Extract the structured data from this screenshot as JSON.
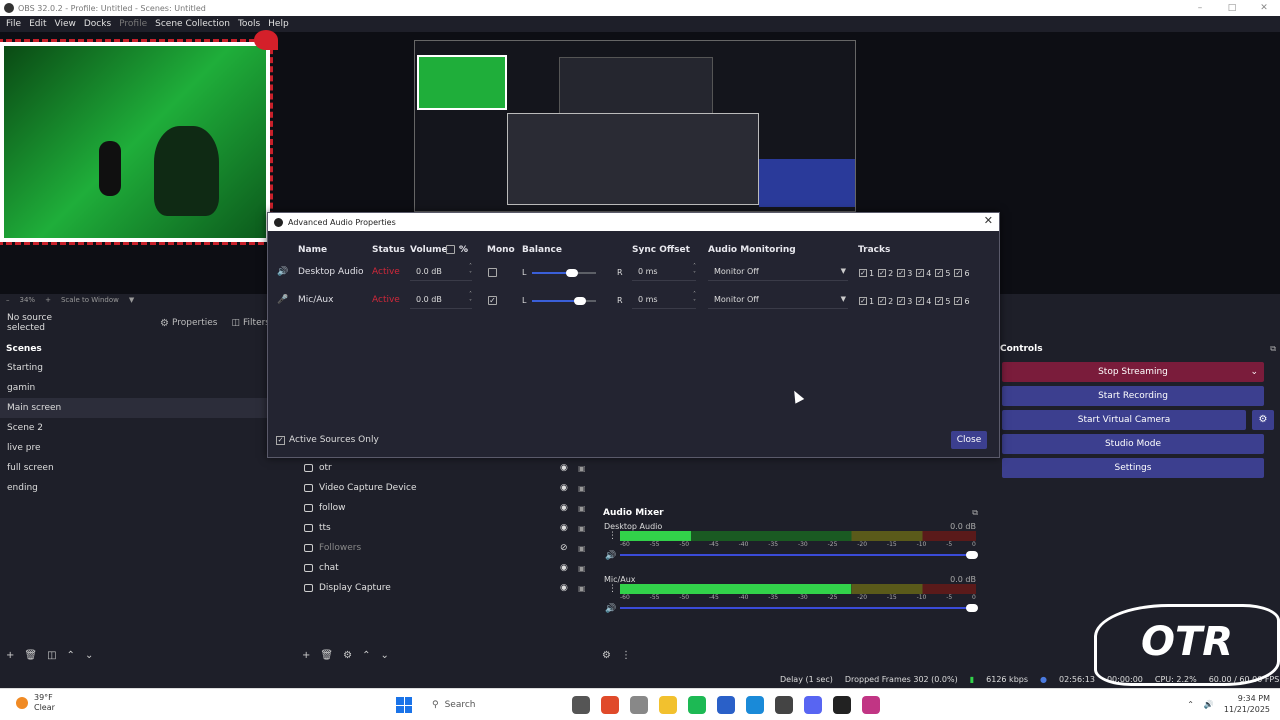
{
  "window": {
    "title": "OBS 32.0.2 - Profile: Untitled - Scenes: Untitled"
  },
  "menu": [
    {
      "label": "File",
      "dim": false
    },
    {
      "label": "Edit",
      "dim": false
    },
    {
      "label": "View",
      "dim": false
    },
    {
      "label": "Docks",
      "dim": false
    },
    {
      "label": "Profile",
      "dim": true
    },
    {
      "label": "Scene Collection",
      "dim": false
    },
    {
      "label": "Tools",
      "dim": false
    },
    {
      "label": "Help",
      "dim": false
    }
  ],
  "preview": {
    "zoom": "34%",
    "scale_mode": "Scale to Window"
  },
  "source_toolbar": {
    "no_selection": "No source selected",
    "properties": "Properties",
    "filters": "Filters"
  },
  "scenes": {
    "title": "Scenes",
    "items": [
      "Starting",
      "gamin",
      "Main screen",
      "Scene 2",
      "live pre",
      "full screen",
      "ending"
    ],
    "selected_index": 2
  },
  "sources": [
    {
      "name": "otr",
      "dim": false
    },
    {
      "name": "Video Capture Device",
      "dim": false
    },
    {
      "name": "follow",
      "dim": false
    },
    {
      "name": "tts",
      "dim": false
    },
    {
      "name": "Followers",
      "dim": true
    },
    {
      "name": "chat",
      "dim": false
    },
    {
      "name": "Display Capture",
      "dim": false
    }
  ],
  "mixer": {
    "title": "Audio Mixer",
    "scale": [
      "-60",
      "-55",
      "-50",
      "-45",
      "-40",
      "-35",
      "-30",
      "-25",
      "-20",
      "-15",
      "-10",
      "-5",
      "0"
    ],
    "channels": [
      {
        "name": "Desktop Audio",
        "db": "0.0 dB",
        "level": 0.2,
        "volume": 1.0
      },
      {
        "name": "Mic/Aux",
        "db": "0.0 dB",
        "level": 0.65,
        "volume": 1.0
      }
    ]
  },
  "controls": {
    "title": "Controls",
    "stop_streaming": "Stop Streaming",
    "start_recording": "Start Recording",
    "start_virtual_camera": "Start Virtual Camera",
    "studio_mode": "Studio Mode",
    "settings": "Settings"
  },
  "status": {
    "delay": "Delay (1 sec)",
    "dropped_frames": "Dropped Frames 302 (0.0%)",
    "bitrate": "6126 kbps",
    "stream_time": "02:56:13",
    "rec_time": "00:00:00",
    "cpu": "CPU: 2.2%",
    "fps": "60.00 / 60.00 FPS"
  },
  "dialog": {
    "title": "Advanced Audio Properties",
    "headers": {
      "name": "Name",
      "status": "Status",
      "volume": "Volume",
      "percent": "%",
      "mono": "Mono",
      "balance": "Balance",
      "sync_offset": "Sync Offset",
      "audio_monitoring": "Audio Monitoring",
      "tracks": "Tracks"
    },
    "balance_left": "L",
    "balance_right": "R",
    "rows": [
      {
        "name": "Desktop Audio",
        "status": "Active",
        "volume": "0.0 dB",
        "mono": false,
        "balance": 0.63,
        "sync": "0 ms",
        "monitoring": "Monitor Off",
        "tracks": [
          "1",
          "2",
          "3",
          "4",
          "5",
          "6"
        ]
      },
      {
        "name": "Mic/Aux",
        "status": "Active",
        "volume": "0.0 dB",
        "mono": true,
        "balance": 0.75,
        "sync": "0 ms",
        "monitoring": "Monitor Off",
        "tracks": [
          "1",
          "2",
          "3",
          "4",
          "5",
          "6"
        ]
      }
    ],
    "active_sources_only": "Active Sources Only",
    "close": "Close"
  },
  "taskbar": {
    "weather_temp": "39°F",
    "weather_desc": "Clear",
    "search": "Search",
    "time": "9:34 PM",
    "date": "11/21/2025"
  },
  "overlay_logo": "OTR"
}
